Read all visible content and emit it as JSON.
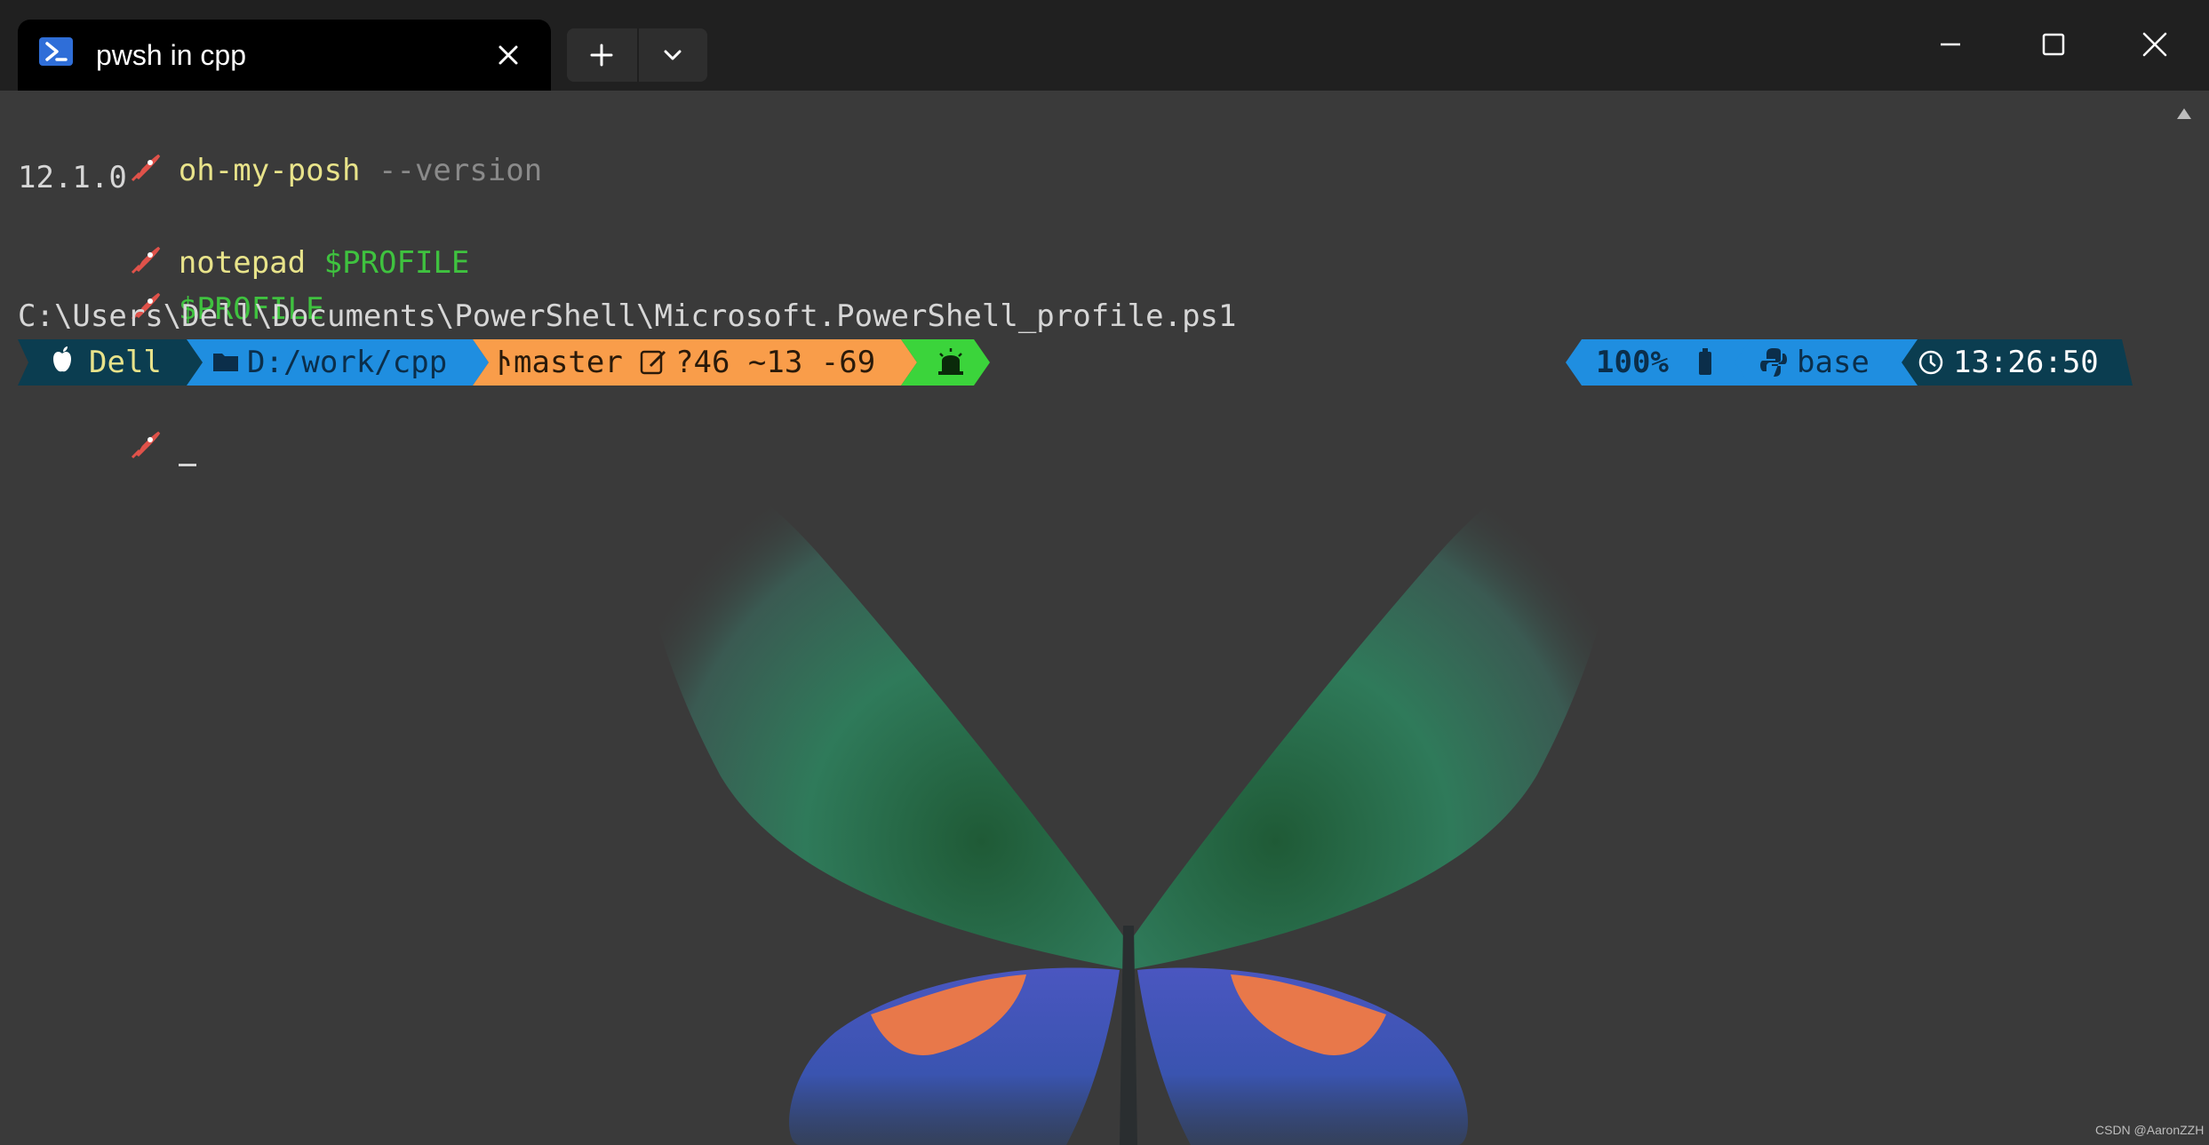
{
  "window": {
    "tab_title": "pwsh in cpp",
    "tab_icon": "powershell-icon",
    "colors": {
      "titlebar": "#202020",
      "tab_active": "#000000",
      "terminal_bg": "#3a3a3a"
    }
  },
  "terminal": {
    "lines": [
      {
        "command": "oh-my-posh",
        "argument": "--version"
      },
      {
        "output": "12.1.0"
      },
      {
        "command": "notepad",
        "argument": "$PROFILE"
      },
      {
        "variable": "$PROFILE"
      },
      {
        "output": "C:\\Users\\Dell\\Documents\\PowerShell\\Microsoft.PowerShell_profile.ps1"
      }
    ],
    "cursor": "_"
  },
  "prompt": {
    "left_segments": [
      {
        "icon": "apple-icon",
        "text": "Dell",
        "bg": "#0b3d50",
        "fg": "#e8e38a"
      },
      {
        "icon": "folder-icon",
        "text": "D:/work/cpp",
        "bg": "#1f8ee0",
        "fg": "#0b2e4a"
      },
      {
        "icon": "git-branch-icon",
        "text": "master",
        "status_icon": "edit-icon",
        "status": "?46 ~13 -69",
        "bg": "#f99d4a",
        "fg": "#2a1a0a"
      },
      {
        "icon": "alarm-icon",
        "text": "",
        "bg": "#3bd43b",
        "fg": "#0a2a0a"
      }
    ],
    "right_segments": [
      {
        "text": "100%",
        "icon": "battery-icon",
        "bg": "#1f8ee0",
        "fg": "#0b2e4a"
      },
      {
        "icon": "python-icon",
        "text": "base",
        "bg": "#1f8ee0",
        "fg": "#0b2e4a"
      },
      {
        "icon": "clock-icon",
        "text": "13:26:50",
        "bg": "#0b3d50",
        "fg": "#ffffff"
      }
    ]
  },
  "watermark": "CSDN @AaronZZH"
}
